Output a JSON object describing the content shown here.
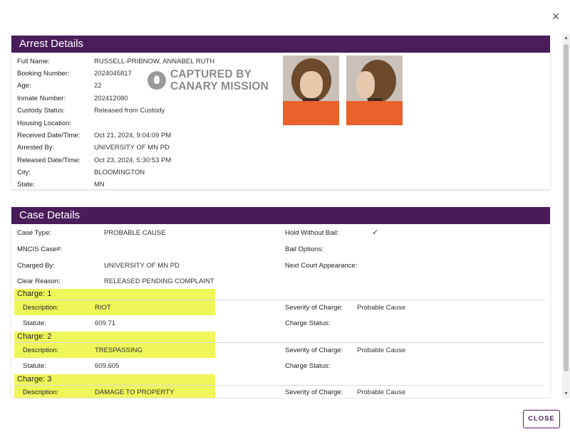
{
  "dialog": {
    "close_icon": "×",
    "close_button_label": "CLOSE"
  },
  "arrest": {
    "title": "Arrest Details",
    "fields": [
      {
        "label": "Full Name:",
        "value": "RUSSELL-PRIBNOW, ANNABEL RUTH"
      },
      {
        "label": "Booking Number:",
        "value": "2024045817"
      },
      {
        "label": "Age:",
        "value": "22"
      },
      {
        "label": "Inmate Number:",
        "value": "202412080"
      },
      {
        "label": "Custody Status:",
        "value": "Released from Custody"
      },
      {
        "label": "Housing Location:",
        "value": ""
      },
      {
        "label": "Received Date/Time:",
        "value": "Oct 21, 2024, 9:04:09 PM"
      },
      {
        "label": "Arrested By:",
        "value": "UNIVERSITY OF MN PD"
      },
      {
        "label": "Released Date/Time:",
        "value": "Oct 23, 2024, 5:30:53 PM"
      },
      {
        "label": "City:",
        "value": "BLOOMINGTON"
      },
      {
        "label": "State:",
        "value": "MN"
      }
    ],
    "watermark_line1": "CAPTURED BY",
    "watermark_line2": "CANARY MISSION"
  },
  "case": {
    "title": "Case Details",
    "left_fields": [
      {
        "label": "Case Type:",
        "value": "PROBABLE CAUSE"
      },
      {
        "label": "MNCIS Case#:",
        "value": ""
      },
      {
        "label": "Charged By:",
        "value": "UNIVERSITY OF MN PD"
      },
      {
        "label": "Clear Reason:",
        "value": "RELEASED PENDING COMPLAINT"
      }
    ],
    "right_fields": [
      {
        "label": "Hold Without Bail:",
        "value": "✓"
      },
      {
        "label": "Bail Options:",
        "value": ""
      },
      {
        "label": "Next Court Appearance:",
        "value": ""
      }
    ],
    "charges": [
      {
        "title": "Charge: 1",
        "desc_label": "Description:",
        "desc": "RIOT",
        "statute_label": "Statute:",
        "statute": "609.71",
        "severity_label": "Severity of Charge:",
        "severity": "Probable Cause",
        "status_label": "Charge Status:",
        "status": ""
      },
      {
        "title": "Charge: 2",
        "desc_label": "Description:",
        "desc": "TRESPASSING",
        "statute_label": "Statute:",
        "statute": "609.605",
        "severity_label": "Severity of Charge:",
        "severity": "Probable Cause",
        "status_label": "Charge Status:",
        "status": ""
      },
      {
        "title": "Charge: 3",
        "desc_label": "Description:",
        "desc": "DAMAGE TO PROPERTY",
        "severity_label": "Severity of Charge:",
        "severity": "Probable Cause"
      }
    ]
  },
  "colors": {
    "header": "#4a1d5a",
    "highlight": "#eef65a"
  }
}
